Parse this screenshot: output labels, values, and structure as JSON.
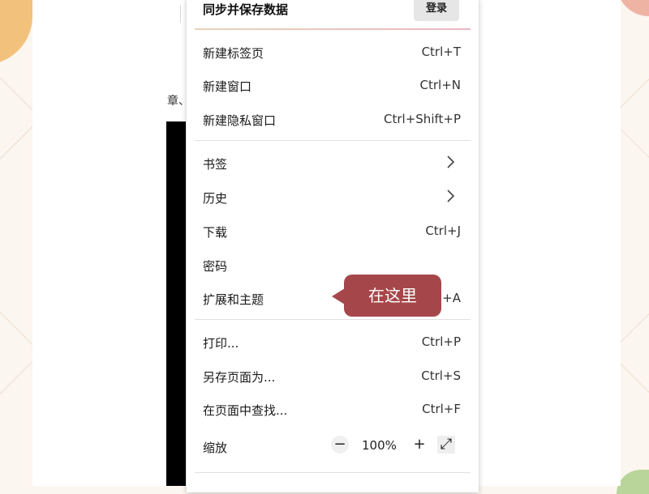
{
  "menu": {
    "header": {
      "title": "同步并保存数据",
      "login": "登录"
    },
    "items": [
      {
        "label": "新建标签页",
        "shortcut": "Ctrl+T"
      },
      {
        "label": "新建窗口",
        "shortcut": "Ctrl+N"
      },
      {
        "label": "新建隐私窗口",
        "shortcut": "Ctrl+Shift+P"
      },
      {
        "label": "书签",
        "icon": "chevron-right-icon"
      },
      {
        "label": "历史",
        "icon": "chevron-right-icon"
      },
      {
        "label": "下载",
        "shortcut": "Ctrl+J"
      },
      {
        "label": "密码"
      },
      {
        "label": "扩展和主题",
        "shortcut": "+A"
      },
      {
        "label": "打印...",
        "shortcut": "Ctrl+P"
      },
      {
        "label": "另存页面为...",
        "shortcut": "Ctrl+S"
      },
      {
        "label": "在页面中查找...",
        "shortcut": "Ctrl+F"
      }
    ],
    "zoom": {
      "label": "缩放",
      "minus": "−",
      "value": "100%",
      "plus": "+",
      "fullscreen": "⤢"
    }
  },
  "page": {
    "text": "章、"
  },
  "callout": {
    "text": "在这里"
  },
  "colors": {
    "callout": "#a5474a",
    "accent_line": "#e9b7c4"
  }
}
